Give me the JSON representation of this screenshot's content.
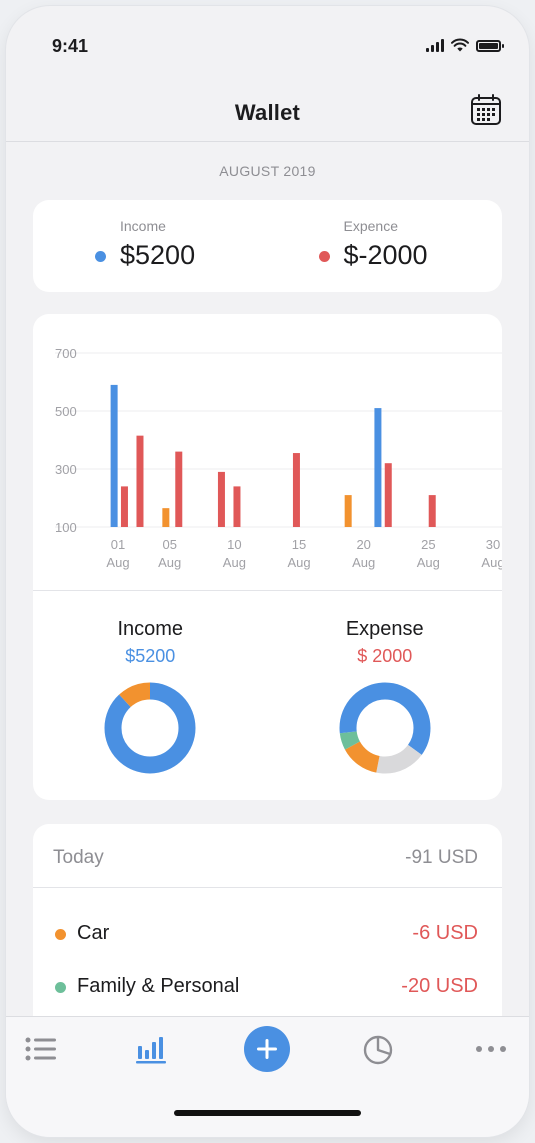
{
  "status_bar": {
    "time": "9:41"
  },
  "header": {
    "title": "Wallet",
    "calendar_icon": "calendar-icon"
  },
  "period": {
    "label": "AUGUST 2019"
  },
  "summary": {
    "income": {
      "label": "Income",
      "value": "$5200",
      "color": "#4a90e2"
    },
    "expense": {
      "label": "Expence",
      "value": "$-2000",
      "color": "#e05858"
    }
  },
  "colors": {
    "income": "#4a90e2",
    "expense": "#e05858",
    "orange": "#f2922f",
    "green": "#6dbf9a",
    "gray": "#d9d9db"
  },
  "chart_data": [
    {
      "type": "bar",
      "title": "",
      "xlabel": "",
      "ylabel": "",
      "y_ticks": [
        "700",
        "500",
        "300",
        "100"
      ],
      "ylim": [
        100,
        700
      ],
      "x_ticks": [
        {
          "day": 1,
          "top": "01",
          "bottom": "Aug"
        },
        {
          "day": 5,
          "top": "05",
          "bottom": "Aug"
        },
        {
          "day": 10,
          "top": "10",
          "bottom": "Aug"
        },
        {
          "day": 15,
          "top": "15",
          "bottom": "Aug"
        },
        {
          "day": 20,
          "top": "20",
          "bottom": "Aug"
        },
        {
          "day": 25,
          "top": "25",
          "bottom": "Aug"
        },
        {
          "day": 30,
          "top": "30",
          "bottom": "Aug"
        }
      ],
      "bars": [
        {
          "day": 0.7,
          "value": 590,
          "color": "#4a90e2"
        },
        {
          "day": 1.5,
          "value": 240,
          "color": "#e05858"
        },
        {
          "day": 2.7,
          "value": 415,
          "color": "#e05858"
        },
        {
          "day": 4.7,
          "value": 165,
          "color": "#f2922f"
        },
        {
          "day": 5.7,
          "value": 360,
          "color": "#e05858"
        },
        {
          "day": 9.0,
          "value": 290,
          "color": "#e05858"
        },
        {
          "day": 10.2,
          "value": 240,
          "color": "#e05858"
        },
        {
          "day": 14.8,
          "value": 355,
          "color": "#e05858"
        },
        {
          "day": 18.8,
          "value": 210,
          "color": "#f2922f"
        },
        {
          "day": 21.1,
          "value": 510,
          "color": "#4a90e2"
        },
        {
          "day": 21.9,
          "value": 320,
          "color": "#e05858"
        },
        {
          "day": 25.3,
          "value": 210,
          "color": "#e05858"
        }
      ]
    },
    {
      "type": "pie",
      "title": "Income",
      "total": "$5200",
      "slices": [
        {
          "value": 88,
          "color": "#4a90e2"
        },
        {
          "value": 12,
          "color": "#f2922f"
        }
      ]
    },
    {
      "type": "pie",
      "title": "Expense",
      "total": "$ 2000",
      "slices": [
        {
          "value": 35,
          "color": "#4a90e2"
        },
        {
          "value": 18,
          "color": "#d9d9db"
        },
        {
          "value": 14,
          "color": "#f2922f"
        },
        {
          "value": 6,
          "color": "#6dbf9a"
        },
        {
          "value": 27,
          "color": "#4a90e2"
        }
      ]
    }
  ],
  "donuts": {
    "income": {
      "title": "Income",
      "amount": "$5200"
    },
    "expense": {
      "title": "Expense",
      "amount": "$ 2000"
    }
  },
  "transactions": {
    "header": {
      "label": "Today",
      "total": "-91 USD"
    },
    "rows": [
      {
        "name": "Car",
        "amount": "-6 USD",
        "dot_color": "#f2922f"
      },
      {
        "name": "Family & Personal",
        "amount": "-20 USD",
        "dot_color": "#6dbf9a"
      }
    ]
  },
  "tab_bar": {
    "items": [
      {
        "icon": "list-icon",
        "active": false
      },
      {
        "icon": "bar-chart-icon",
        "active": true
      },
      {
        "icon": "add-icon",
        "active": false
      },
      {
        "icon": "pie-chart-icon",
        "active": false
      },
      {
        "icon": "more-icon",
        "active": false
      }
    ]
  }
}
